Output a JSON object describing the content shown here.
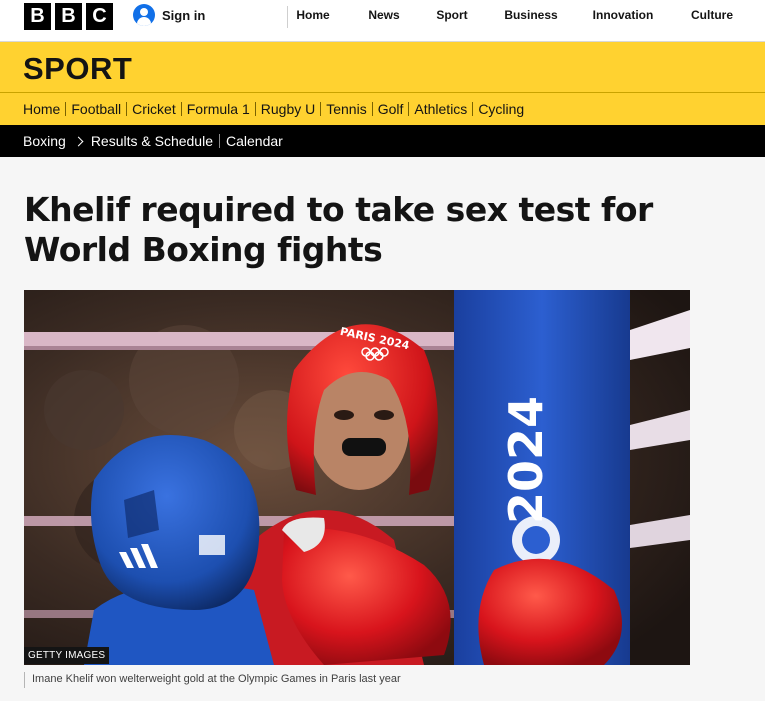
{
  "header": {
    "logo_letters": [
      "B",
      "B",
      "C"
    ],
    "sign_in_label": "Sign in",
    "nav": [
      "Home",
      "News",
      "Sport",
      "Business",
      "Innovation",
      "Culture"
    ]
  },
  "sport_banner": {
    "title": "SPORT"
  },
  "sport_nav": [
    "Home",
    "Football",
    "Cricket",
    "Formula 1",
    "Rugby U",
    "Tennis",
    "Golf",
    "Athletics",
    "Cycling"
  ],
  "sub_nav": {
    "section": "Boxing",
    "items": [
      "Results & Schedule",
      "Calendar"
    ]
  },
  "article": {
    "headline": "Khelif required to take sex test for World Boxing fights",
    "image": {
      "credit": "GETTY IMAGES",
      "caption": "Imane Khelif won welterweight gold at the Olympic Games in Paris last year",
      "headgear_text": "PARIS 2024",
      "post_text": "2024"
    }
  },
  "colors": {
    "sport_yellow": "#ffd230",
    "signin_blue": "#1170e8",
    "nav_black": "#000000",
    "glove_red": "#d8141c",
    "opponent_blue": "#1d4fb0"
  },
  "icons": {
    "signin": "user-account-icon",
    "breadcrumb_separator": "chevron-right-icon"
  }
}
